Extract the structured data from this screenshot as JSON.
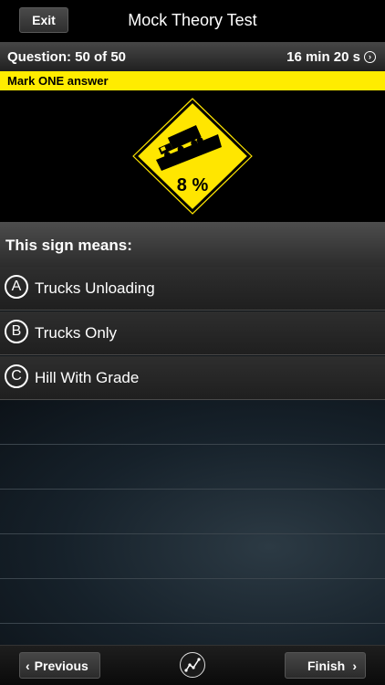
{
  "navbar": {
    "exit_label": "Exit",
    "title": "Mock Theory Test"
  },
  "question_bar": {
    "question_label": "Question: 50 of 50",
    "timer": "16 min 20 s",
    "timer_icon": "timer-icon"
  },
  "instruction": "Mark ONE answer",
  "sign": {
    "grade_text": "8 %",
    "fill_color": "#FFE600",
    "icon": "truck-downhill-grade-sign"
  },
  "prompt": "This sign means:",
  "options": [
    {
      "letter": "A",
      "text": "Trucks Unloading"
    },
    {
      "letter": "B",
      "text": "Trucks Only"
    },
    {
      "letter": "C",
      "text": "Hill With Grade"
    }
  ],
  "toolbar": {
    "previous_label": "Previous",
    "finish_label": "Finish",
    "stats_icon": "chart-line-icon"
  }
}
